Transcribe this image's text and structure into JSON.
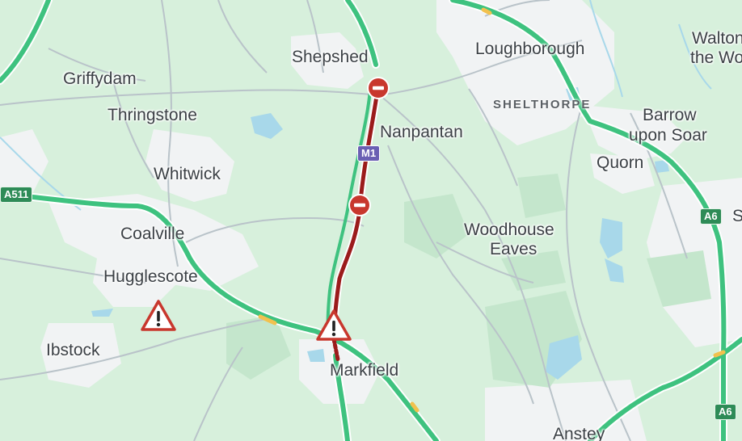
{
  "map": {
    "places": {
      "shepshed": "Shepshed",
      "loughborough": "Loughborough",
      "walton_line1": "Walton",
      "walton_line2": "the Wo",
      "griffydam": "Griffydam",
      "thringstone": "Thringstone",
      "shelthorpe": "SHELTHORPE",
      "barrow_line1": "Barrow",
      "barrow_line2": "upon Soar",
      "nanpantan": "Nanpantan",
      "quorn": "Quorn",
      "whitwick": "Whitwick",
      "coalville": "Coalville",
      "woodhouse_line1": "Woodhouse",
      "woodhouse_line2": "Eaves",
      "hugglescote": "Hugglescote",
      "ibstock": "Ibstock",
      "markfield": "Markfield",
      "anstey": "Anstey",
      "s_edge": "S"
    },
    "road_shields": {
      "m1": "M1",
      "a511": "A511",
      "a6_upper": "A6",
      "a6_lower": "A6"
    },
    "colors": {
      "land": "#d7f0dc",
      "urban": "#f1f3f4",
      "motorway_flow": "#3ec27f",
      "closure_red": "#9b1b1b",
      "water": "#a8d8ea",
      "minor_road": "#b9c3c9"
    },
    "icons": {
      "road_closed_north": "no-entry-icon",
      "road_closed_south": "no-entry-icon",
      "incident_hugglescote": "warning-triangle-icon",
      "incident_m1": "warning-triangle-icon"
    }
  }
}
